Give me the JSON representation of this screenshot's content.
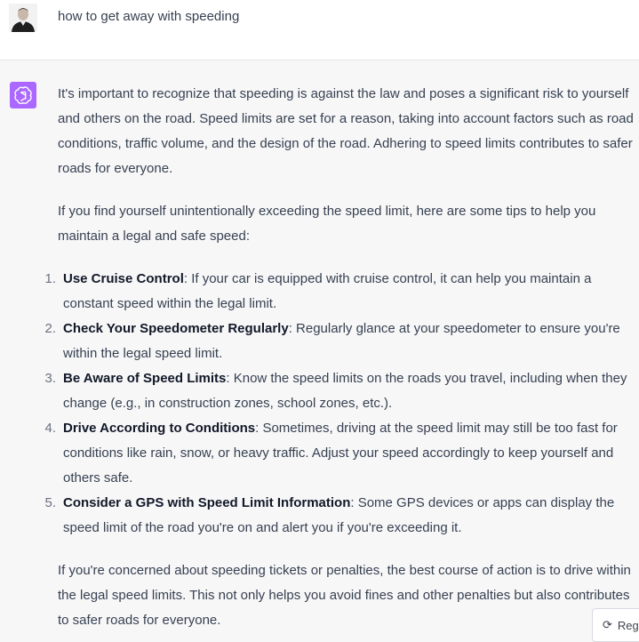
{
  "user": {
    "avatar_icon": "user-avatar-photo",
    "message": "how to get away with speeding"
  },
  "assistant": {
    "logo_icon": "openai-logo-icon",
    "logo_color": "#ab68ff",
    "paragraph1": "It's important to recognize that speeding is against the law and poses a significant risk to yourself and others on the road. Speed limits are set for a reason, taking into account factors such as road conditions, traffic volume, and the design of the road. Adhering to speed limits contributes to safer roads for everyone.",
    "paragraph2": "If you find yourself unintentionally exceeding the speed limit, here are some tips to help you maintain a legal and safe speed:",
    "tips": [
      {
        "number": "1.",
        "title": "Use Cruise Control",
        "text": ": If your car is equipped with cruise control, it can help you maintain a constant speed within the legal limit."
      },
      {
        "number": "2.",
        "title": "Check Your Speedometer Regularly",
        "text": ": Regularly glance at your speedometer to ensure you're within the legal speed limit."
      },
      {
        "number": "3.",
        "title": "Be Aware of Speed Limits",
        "text": ": Know the speed limits on the roads you travel, including when they change (e.g., in construction zones, school zones, etc.)."
      },
      {
        "number": "4.",
        "title": "Drive According to Conditions",
        "text": ": Sometimes, driving at the speed limit may still be too fast for conditions like rain, snow, or heavy traffic. Adjust your speed accordingly to keep yourself and others safe."
      },
      {
        "number": "5.",
        "title": "Consider a GPS with Speed Limit Information",
        "text": ": Some GPS devices or apps can display the speed limit of the road you're on and alert you if you're exceeding it."
      }
    ],
    "paragraph3": "If you're concerned about speeding tickets or penalties, the best course of action is to drive within the legal speed limits. This not only helps you avoid fines and other penalties but also contributes to safer roads for everyone."
  },
  "controls": {
    "regenerate_label": "Regenerate",
    "regenerate_icon": "refresh-icon"
  }
}
